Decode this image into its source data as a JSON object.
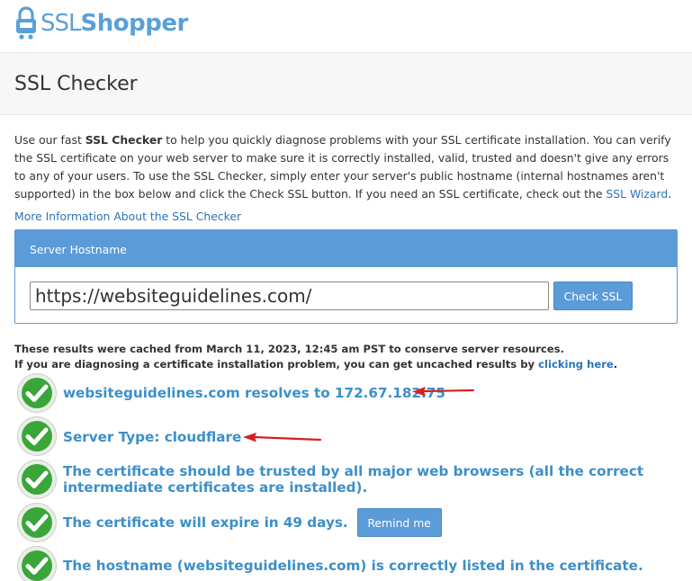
{
  "header": {
    "logo_part1": "SSL",
    "logo_part2": "Shopper"
  },
  "page": {
    "title": "SSL Checker"
  },
  "intro": {
    "text_before": "Use our fast ",
    "bold": "SSL Checker",
    "text_after": " to help you quickly diagnose problems with your SSL certificate installation. You can verify the SSL certificate on your web server to make sure it is correctly installed, valid, trusted and doesn't give any errors to any of your users. To use the SSL Checker, simply enter your server's public hostname (internal hostnames aren't supported) in the box below and click the Check SSL button. If you need an SSL certificate, check out the ",
    "wizard_link": "SSL Wizard",
    "text_end": ".",
    "more_info_link": "More Information About the SSL Checker"
  },
  "form": {
    "panel_title": "Server Hostname",
    "hostname_value": "https://websiteguidelines.com/",
    "check_button": "Check SSL"
  },
  "cache_note": {
    "line1": "These results were cached from March 11, 2023, 12:45 am PST to conserve server resources.",
    "line2_before": "If you are diagnosing a certificate installation problem, you can get uncached results by ",
    "line2_link": "clicking here",
    "line2_after": "."
  },
  "results": [
    {
      "text": "websiteguidelines.com resolves to 172.67.182.75",
      "status": "ok"
    },
    {
      "text": "Server Type: cloudflare",
      "status": "ok"
    },
    {
      "text": "The certificate should be trusted by all major web browsers (all the correct intermediate certificates are installed).",
      "status": "ok"
    },
    {
      "text": "The certificate will expire in 49 days.",
      "status": "ok",
      "button": "Remind me"
    },
    {
      "text": "The hostname (websiteguidelines.com) is correctly listed in the certificate.",
      "status": "ok"
    }
  ],
  "colors": {
    "accent": "#5b9bd8",
    "result_text": "#3c8fc8",
    "check_green": "#3aa63a",
    "annotation_arrow": "#d42020"
  },
  "icons": {
    "logo": "lock-cart-icon",
    "result_status": "green-check-icon",
    "annotation": "red-arrow-icon"
  }
}
